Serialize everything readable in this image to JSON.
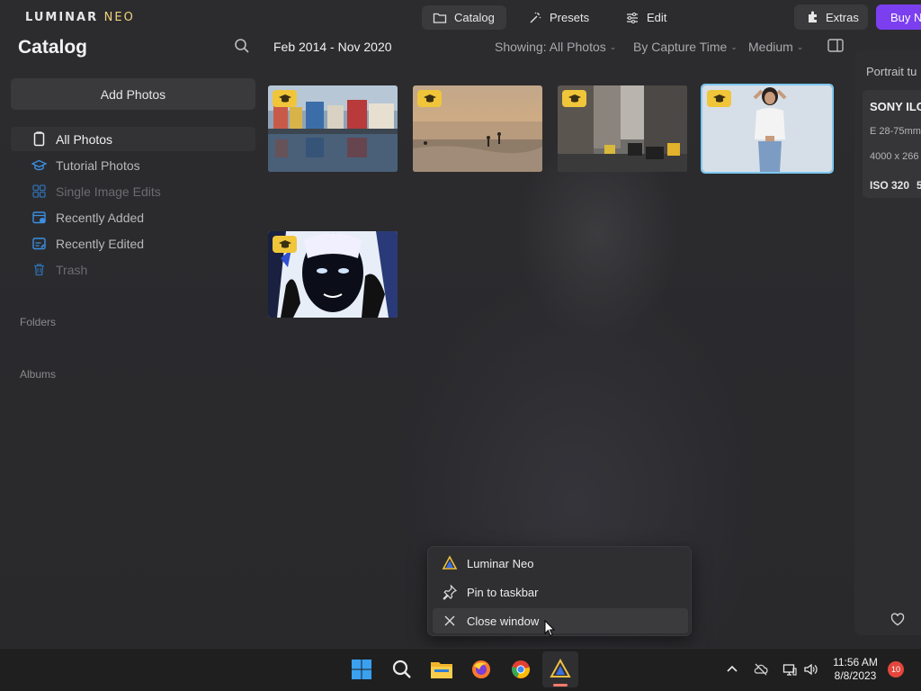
{
  "app": {
    "logo_main": "LUMINAR",
    "logo_accent": "NEO"
  },
  "topnav": {
    "catalog": "Catalog",
    "presets": "Presets",
    "edit": "Edit",
    "extras": "Extras",
    "buy": "Buy N"
  },
  "sidebar": {
    "title": "Catalog",
    "add_photos": "Add Photos",
    "items": [
      {
        "label": "All Photos",
        "icon": "phone-icon"
      },
      {
        "label": "Tutorial Photos",
        "icon": "graduation-cap-icon"
      },
      {
        "label": "Single Image Edits",
        "icon": "grid-icon"
      },
      {
        "label": "Recently Added",
        "icon": "calendar-plus-icon"
      },
      {
        "label": "Recently Edited",
        "icon": "calendar-edit-icon"
      },
      {
        "label": "Trash",
        "icon": "trash-icon"
      }
    ],
    "folders_label": "Folders",
    "albums_label": "Albums"
  },
  "header": {
    "date_range": "Feb 2014 - Nov 2020",
    "showing": "Showing: All Photos",
    "sort": "By Capture Time",
    "size": "Medium"
  },
  "right_panel": {
    "title": "Portrait tu",
    "camera": "SONY ILC",
    "lens": "E 28-75mm",
    "dimensions": "4000 x 266",
    "iso": "ISO 320",
    "extra": "5"
  },
  "context_menu": {
    "items": [
      "Luminar Neo",
      "Pin to taskbar",
      "Close window"
    ]
  },
  "taskbar": {
    "time": "11:56 AM",
    "date": "8/8/2023",
    "notifications": "10"
  },
  "colors": {
    "accent_purple": "#7b3ff0",
    "badge_yellow": "#f0c53a",
    "selection_blue": "#7ec8f0",
    "icon_blue": "#3b8fe0"
  }
}
